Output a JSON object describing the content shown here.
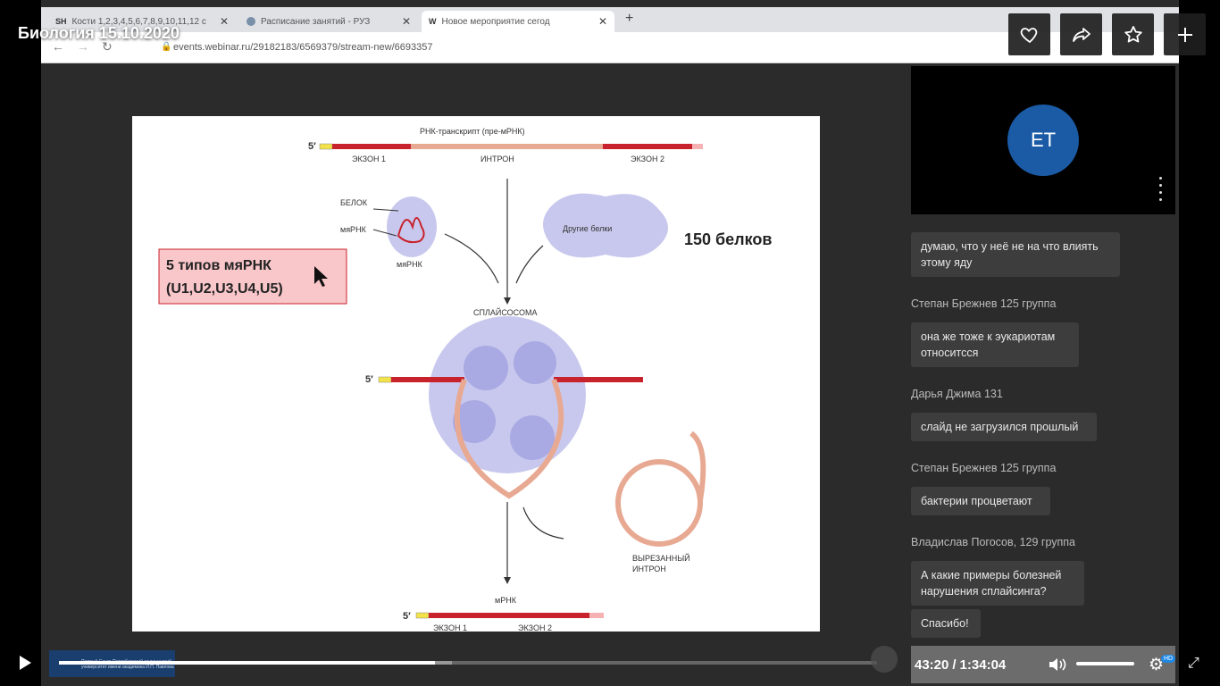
{
  "browser": {
    "tabs": [
      {
        "icon": "SH",
        "label": "Кости 1,2,3,4,5,6,7,8,9,10,11,12 ст"
      },
      {
        "icon": "globe",
        "label": "Расписание занятий - РУЗ"
      },
      {
        "icon": "W",
        "label": "Новое мероприятие сегод"
      }
    ],
    "url": "events.webinar.ru/29182183/6569379/stream-new/6693357"
  },
  "video": {
    "title": "Биология 15.10.2020"
  },
  "slide": {
    "top_label": "РНК-транскрипт (пре-мРНК)",
    "five_prime": "5′",
    "exon1": "ЭКЗОН 1",
    "intron": "ИНТРОН",
    "exon2": "ЭКЗОН 2",
    "protein": "БЕЛОК",
    "snrna": "мяРНК",
    "snrna_below": "мяРНК",
    "other_proteins": "Другие белки",
    "count_proteins": "150 белков",
    "box_line1": "5 типов мяРНК",
    "box_line2": "(U1,U2,U3,U4,U5)",
    "spliceosome": "СПЛАЙСОСОМА",
    "cut_intron_1": "ВЫРЕЗАННЫЙ",
    "cut_intron_2": "ИНТРОН",
    "mrna": "мРНК",
    "exon1_bottom": "ЭКЗОН 1",
    "exon2_bottom": "ЭКЗОН 2"
  },
  "speaker": {
    "initials": "ЕТ"
  },
  "chat": {
    "messages": [
      {
        "author": "",
        "text_line1": "думаю, что у неё не на что влиять",
        "text_line2": "этому яду"
      },
      {
        "author": "Степан Брежнев 125 группа",
        "text_line1": "она же тоже к эукариотам",
        "text_line2": "относитсся"
      },
      {
        "author": "Дарья Джима 131",
        "text_line1": "слайд не загрузился прошлый",
        "text_line2": ""
      },
      {
        "author": "Степан Брежнев 125 группа",
        "text_line1": "бактерии процветают",
        "text_line2": ""
      },
      {
        "author": "Владислав Погосов, 129 группа",
        "text_line1": "А какие примеры болезней",
        "text_line2": "нарушения сплайсинга?"
      },
      {
        "author": "",
        "text_line1": "Спасибо!",
        "text_line2": ""
      }
    ]
  },
  "player": {
    "current_time": "43:20",
    "separator": "/",
    "duration": "1:34:04",
    "progress": 0.46,
    "buffered": 0.48,
    "volume": 1.0,
    "quality_badge": "HD",
    "logo_text": "Первый Санкт-Петербургский медицинский университет имени академика И.П. Павлова"
  },
  "colors": {
    "accent_blue": "#1b5ba6",
    "rna_red": "#c8232c",
    "box_pink": "#f9c6c9"
  }
}
